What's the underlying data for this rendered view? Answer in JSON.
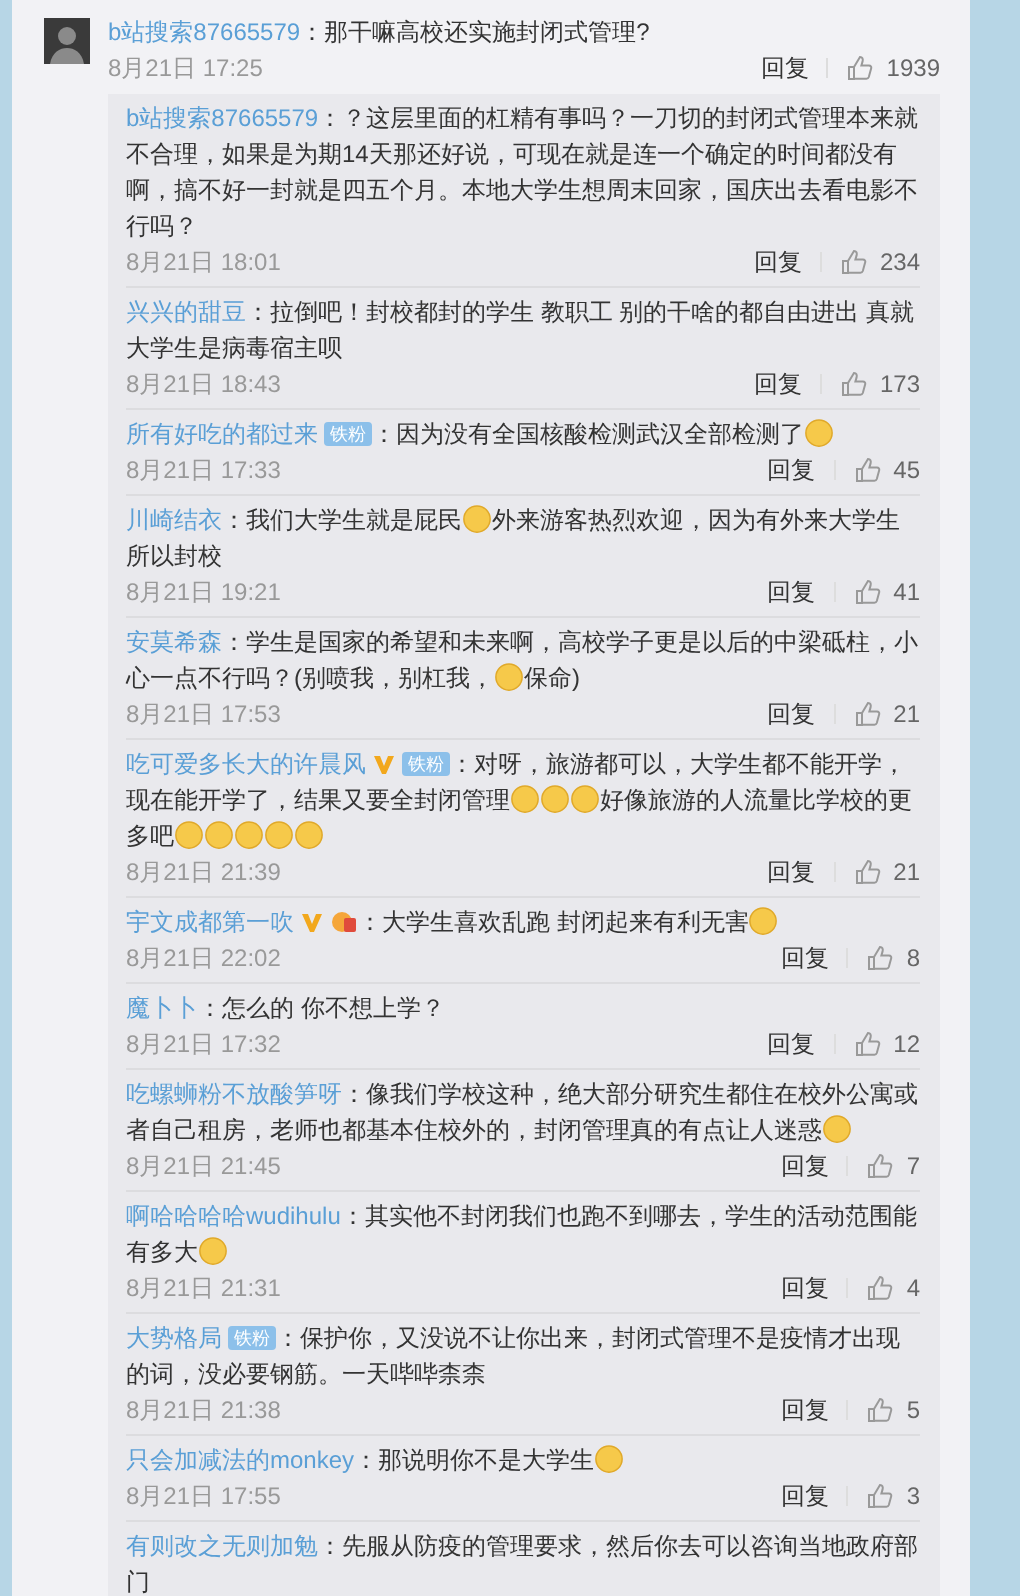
{
  "comment": {
    "name": "b站搜索87665579",
    "text": "：那干嘛高校还实施封闭式管理?",
    "date": "8月21日 17:25",
    "reply_label": "回复",
    "likes": "1939",
    "replies": [
      {
        "name": "b站搜索87665579",
        "parts": [
          {
            "kind": "text",
            "text": "：？这层里面的杠精有事吗？一刀切的封闭式管理本来就不合理，如果是为期14天那还好说，可现在就是连一个确定的时间都没有啊，搞不好一封就是四五个月。本地大学生想周末回家，国庆出去看电影不行吗？"
          }
        ],
        "date": "8月21日 18:01",
        "reply_label": "回复",
        "likes": "234"
      },
      {
        "name": "兴兴的甜豆",
        "parts": [
          {
            "kind": "text",
            "text": "：拉倒吧！封校都封的学生  教职工 别的干啥的都自由进出  真就大学生是病毒宿主呗"
          }
        ],
        "date": "8月21日 18:43",
        "reply_label": "回复",
        "likes": "173"
      },
      {
        "name": "所有好吃的都过来",
        "badges": [
          {
            "kind": "fan",
            "label": "铁粉"
          }
        ],
        "parts": [
          {
            "kind": "text",
            "text": "：因为没有全国核酸检测武汉全部检测了"
          },
          {
            "kind": "emoji"
          }
        ],
        "date": "8月21日 17:33",
        "reply_label": "回复",
        "likes": "45"
      },
      {
        "name": "川崎结衣",
        "parts": [
          {
            "kind": "text",
            "text": "：我们大学生就是屁民"
          },
          {
            "kind": "emoji"
          },
          {
            "kind": "text",
            "text": "外来游客热烈欢迎，因为有外来大学生所以封校"
          }
        ],
        "date": "8月21日 19:21",
        "reply_label": "回复",
        "likes": "41"
      },
      {
        "name": "安莫希森",
        "parts": [
          {
            "kind": "text",
            "text": "：学生是国家的希望和未来啊，高校学子更是以后的中梁砥柱，小心一点不行吗？(别喷我，别杠我，"
          },
          {
            "kind": "emoji"
          },
          {
            "kind": "text",
            "text": "保命)"
          }
        ],
        "date": "8月21日 17:53",
        "reply_label": "回复",
        "likes": "21"
      },
      {
        "name": "吃可爱多长大的许晨风",
        "badges": [
          {
            "kind": "vip"
          },
          {
            "kind": "fan",
            "label": "铁粉"
          }
        ],
        "parts": [
          {
            "kind": "text",
            "text": "：对呀，旅游都可以，大学生都不能开学，现在能开学了，结果又要全封闭管理"
          },
          {
            "kind": "emoji"
          },
          {
            "kind": "emoji"
          },
          {
            "kind": "emoji"
          },
          {
            "kind": "text",
            "text": "好像旅游的人流量比学校的更多吧"
          },
          {
            "kind": "emoji"
          },
          {
            "kind": "emoji"
          },
          {
            "kind": "emoji"
          },
          {
            "kind": "emoji"
          },
          {
            "kind": "emoji"
          }
        ],
        "date": "8月21日 21:39",
        "reply_label": "回复",
        "likes": "21"
      },
      {
        "name": "宇文成都第一吹",
        "badges": [
          {
            "kind": "vip"
          },
          {
            "kind": "medal"
          }
        ],
        "parts": [
          {
            "kind": "text",
            "text": "：大学生喜欢乱跑 封闭起来有利无害"
          },
          {
            "kind": "emoji"
          }
        ],
        "date": "8月21日 22:02",
        "reply_label": "回复",
        "likes": "8"
      },
      {
        "name": "魔卜卜",
        "parts": [
          {
            "kind": "text",
            "text": "：怎么的 你不想上学？"
          }
        ],
        "date": "8月21日 17:32",
        "reply_label": "回复",
        "likes": "12"
      },
      {
        "name": "吃螺蛳粉不放酸笋呀",
        "parts": [
          {
            "kind": "text",
            "text": "：像我们学校这种，绝大部分研究生都住在校外公寓或者自己租房，老师也都基本住校外的，封闭管理真的有点让人迷惑"
          },
          {
            "kind": "emoji"
          }
        ],
        "date": "8月21日 21:45",
        "reply_label": "回复",
        "likes": "7"
      },
      {
        "name": "啊哈哈哈哈wudihulu",
        "parts": [
          {
            "kind": "text",
            "text": "：其实他不封闭我们也跑不到哪去，学生的活动范围能有多大"
          },
          {
            "kind": "emoji"
          }
        ],
        "date": "8月21日 21:31",
        "reply_label": "回复",
        "likes": "4"
      },
      {
        "name": "大势格局",
        "badges": [
          {
            "kind": "fan",
            "label": "铁粉"
          }
        ],
        "parts": [
          {
            "kind": "text",
            "text": "：保护你，又没说不让你出来，封闭式管理不是疫情才出现的词，没必要钢筋。一天哔哔柰柰"
          }
        ],
        "date": "8月21日 21:38",
        "reply_label": "回复",
        "likes": "5"
      },
      {
        "name": "只会加减法的monkey",
        "parts": [
          {
            "kind": "text",
            "text": "：那说明你不是大学生"
          },
          {
            "kind": "emoji"
          }
        ],
        "date": "8月21日 17:55",
        "reply_label": "回复",
        "likes": "3"
      },
      {
        "name": "有则改之无则加勉",
        "parts": [
          {
            "kind": "text",
            "text": "：先服从防疫的管理要求，然后你去可以咨询当地政府部门"
          }
        ]
      }
    ]
  }
}
